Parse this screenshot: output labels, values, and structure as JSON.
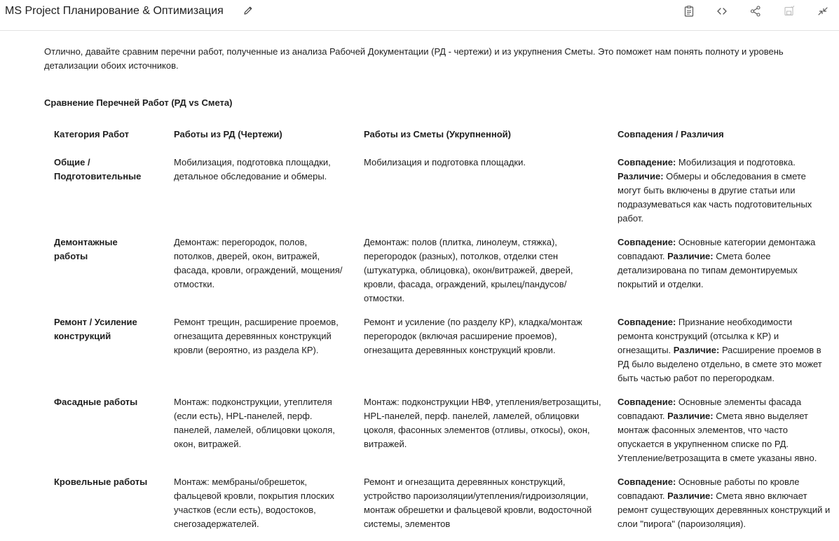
{
  "header": {
    "title": "MS Project Планирование & Оптимизация"
  },
  "toolbar": {
    "icons": [
      "document-icon",
      "code-icon",
      "share-icon",
      "save-icon",
      "collapse-icon"
    ]
  },
  "message": {
    "intro": "Отлично, давайте сравним перечни работ, полученные из анализа Рабочей Документации (РД - чертежи) и из укрупнения Сметы. Это поможет нам понять полноту и уровень детализации обоих источников.",
    "section_title": "Сравнение Перечней Работ (РД vs Смета)"
  },
  "table": {
    "headers": [
      "Категория Работ",
      "Работы из РД (Чертежи)",
      "Работы из Сметы (Укрупненной)",
      "Совпадения / Различия"
    ],
    "label_match": "Совпадение:",
    "label_diff": "Различие:",
    "rows": [
      {
        "category": "Общие / Подготовительные",
        "rd": "Мобилизация, подготовка площадки, детальное обследование и обмеры.",
        "smeta": "Мобилизация и подготовка площадки.",
        "match": "Мобилизация и подготовка.",
        "diff": "Обмеры и обследования в смете могут быть включены в другие статьи или подразумеваться как часть подготовительных работ."
      },
      {
        "category": "Демонтажные работы",
        "rd": "Демонтаж: перегородок, полов, потолков, дверей, окон, витражей, фасада, кровли, ограждений, мощения/отмостки.",
        "smeta": "Демонтаж: полов (плитка, линолеум, стяжка), перегородок (разных), потолков, отделки стен (штукатурка, облицовка), окон/витражей, дверей, кровли, фасада, ограждений, крылец/пандусов/отмостки.",
        "match": "Основные категории демонтажа совпадают.",
        "diff": "Смета более детализирована по типам демонтируемых покрытий и отделки."
      },
      {
        "category": "Ремонт / Усиление конструкций",
        "rd": "Ремонт трещин, расширение проемов, огнезащита деревянных конструкций кровли (вероятно, из раздела КР).",
        "smeta": "Ремонт и усиление (по разделу КР), кладка/монтаж перегородок (включая расширение проемов), огнезащита деревянных конструкций кровли.",
        "match": "Признание необходимости ремонта конструкций (отсылка к КР) и огнезащиты.",
        "diff": "Расширение проемов в РД было выделено отдельно, в смете это может быть частью работ по перегородкам."
      },
      {
        "category": "Фасадные работы",
        "rd": "Монтаж: подконструкции, утеплителя (если есть), HPL-панелей, перф. панелей, ламелей, облицовки цоколя, окон, витражей.",
        "smeta": "Монтаж: подконструкции НВФ, утепления/ветрозащиты, HPL-панелей, перф. панелей, ламелей, облицовки цоколя, фасонных элементов (отливы, откосы), окон, витражей.",
        "match": "Основные элементы фасада совпадают.",
        "diff": "Смета явно выделяет монтаж фасонных элементов, что часто опускается в укрупненном списке по РД. Утепление/ветрозащита в смете указаны явно."
      },
      {
        "category": "Кровельные работы",
        "rd": "Монтаж: мембраны/обрешеток, фальцевой кровли, покрытия плоских участков (если есть), водостоков, снегозадержателей.",
        "smeta": "Ремонт и огнезащита деревянных конструкций, устройство пароизоляции/утепления/гидроизоляции, монтаж обрешетки и фальцевой кровли, водосточной системы, элементов",
        "match": "Основные работы по кровле совпадают.",
        "diff": "Смета явно включает ремонт существующих деревянных конструкций и слои \"пирога\" (пароизоляция)."
      }
    ]
  }
}
